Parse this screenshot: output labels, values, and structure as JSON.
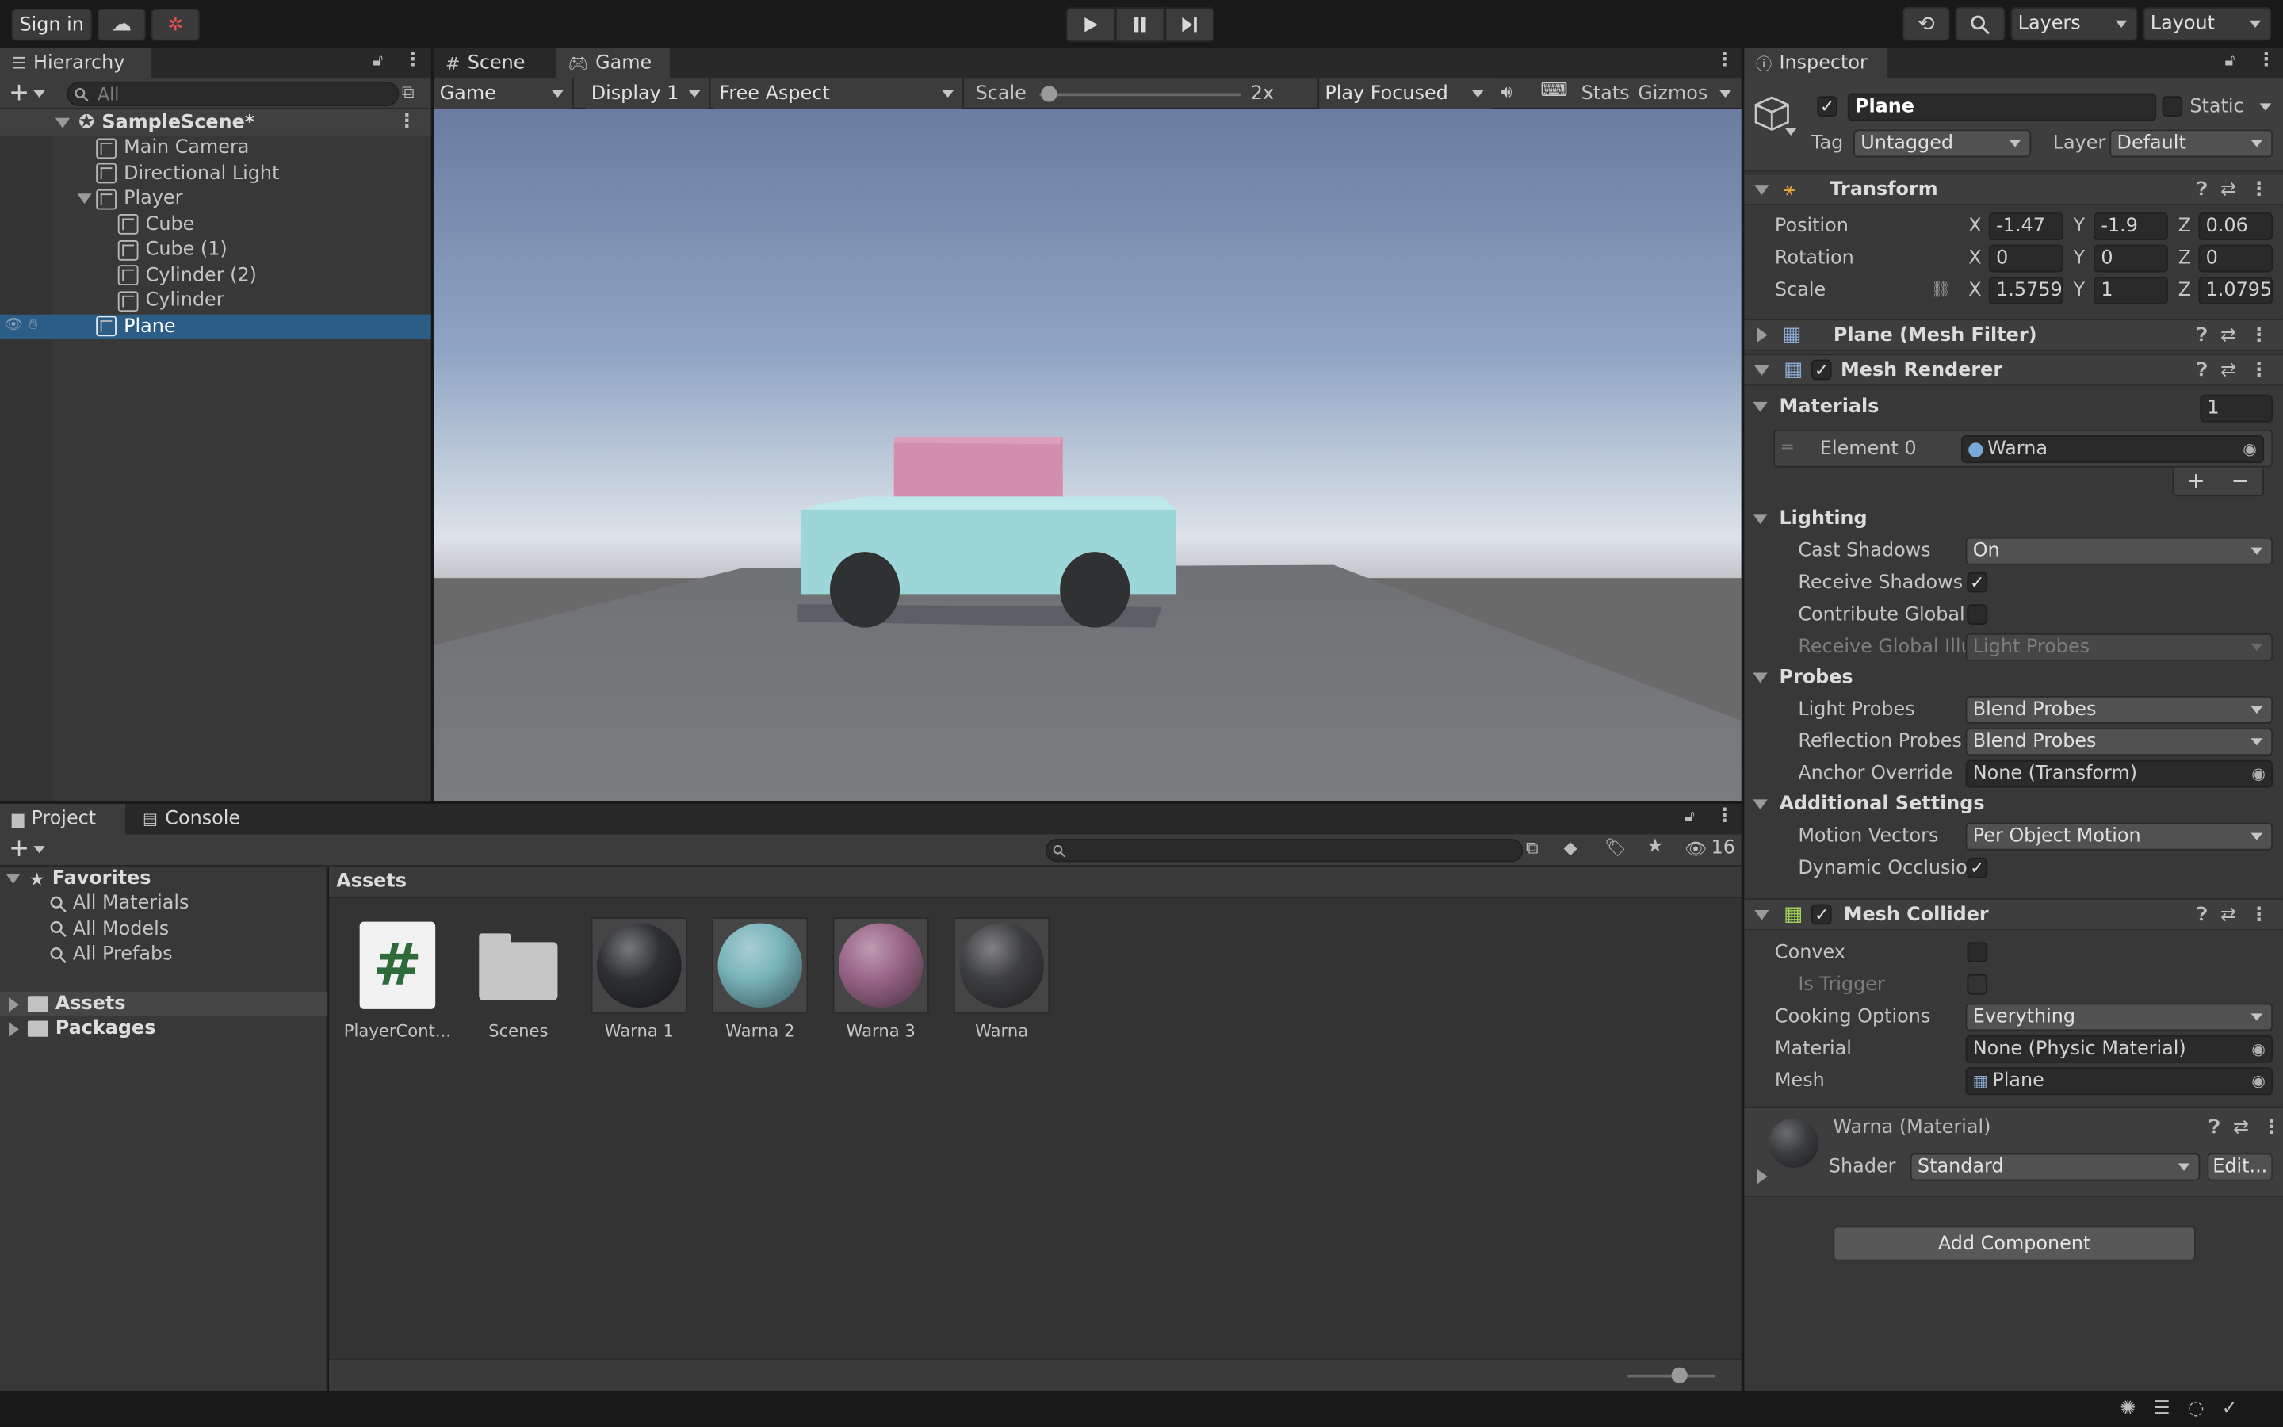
{
  "toolbar": {
    "sign_in": "Sign in",
    "layers": "Layers",
    "layout": "Layout"
  },
  "hierarchy": {
    "tab": "Hierarchy",
    "search_placeholder": "All",
    "scene_name": "SampleScene*",
    "items": [
      {
        "label": "Main Camera",
        "indent": 1
      },
      {
        "label": "Directional Light",
        "indent": 1
      },
      {
        "label": "Player",
        "indent": 1
      },
      {
        "label": "Cube",
        "indent": 2
      },
      {
        "label": "Cube (1)",
        "indent": 2
      },
      {
        "label": "Cylinder (2)",
        "indent": 2
      },
      {
        "label": "Cylinder",
        "indent": 2
      },
      {
        "label": "Plane",
        "indent": 1
      }
    ]
  },
  "view": {
    "tabs": [
      "Scene",
      "Game"
    ],
    "game_dd": "Game",
    "display": "Display 1",
    "aspect": "Free Aspect",
    "scale_label": "Scale",
    "scale_value": 0.02,
    "scale_readout": "2x",
    "play_mode": "Play Focused",
    "stats": "Stats",
    "gizmos": "Gizmos"
  },
  "project": {
    "tabs": [
      "Project",
      "Console"
    ],
    "hidden_count": "16",
    "favorites_label": "Favorites",
    "favorites": [
      "All Materials",
      "All Models",
      "All Prefabs"
    ],
    "roots": [
      "Assets",
      "Packages"
    ],
    "breadcrumb": "Assets",
    "assets": [
      {
        "label": "PlayerCont...",
        "kind": "script"
      },
      {
        "label": "Scenes",
        "kind": "folder"
      },
      {
        "label": "Warna 1",
        "kind": "material",
        "color": "#2e3034"
      },
      {
        "label": "Warna 2",
        "kind": "material",
        "color": "#79b4bb"
      },
      {
        "label": "Warna 3",
        "kind": "material",
        "color": "#9a6688"
      },
      {
        "label": "Warna",
        "kind": "material",
        "color": "#3e3f42"
      }
    ]
  },
  "inspector": {
    "tab": "Inspector",
    "object_name": "Plane",
    "static_label": "Static",
    "tag_label": "Tag",
    "tag_value": "Untagged",
    "layer_label": "Layer",
    "layer_value": "Default",
    "transform": {
      "title": "Transform",
      "rows": [
        {
          "label": "Position",
          "x": "-1.47",
          "y": "-1.9",
          "z": "0.06"
        },
        {
          "label": "Rotation",
          "x": "0",
          "y": "0",
          "z": "0"
        },
        {
          "label": "Scale",
          "x": "1.57593",
          "y": "1",
          "z": "1.0795"
        }
      ]
    },
    "mesh_filter": "Plane (Mesh Filter)",
    "mesh_renderer": "Mesh Renderer",
    "materials_label": "Materials",
    "materials_count": "1",
    "element0_label": "Element 0",
    "element0_value": "Warna",
    "lighting": {
      "title": "Lighting",
      "cast_shadows_label": "Cast Shadows",
      "cast_shadows": "On",
      "receive_shadows_label": "Receive Shadows",
      "contribute_gi_label": "Contribute Global I",
      "receive_gi_label": "Receive Global Illu",
      "receive_gi_value": "Light Probes"
    },
    "probes": {
      "title": "Probes",
      "light_probes_label": "Light Probes",
      "light_probes": "Blend Probes",
      "reflection_probes_label": "Reflection Probes",
      "reflection_probes": "Blend Probes",
      "anchor_label": "Anchor Override",
      "anchor_value": "None (Transform)"
    },
    "additional": {
      "title": "Additional Settings",
      "motion_label": "Motion Vectors",
      "motion_value": "Per Object Motion",
      "dynamic_label": "Dynamic Occlusioi"
    },
    "collider": {
      "title": "Mesh Collider",
      "convex_label": "Convex",
      "trigger_label": "Is Trigger",
      "cooking_label": "Cooking Options",
      "cooking_value": "Everything",
      "material_label": "Material",
      "material_value": "None (Physic Material)",
      "mesh_label": "Mesh",
      "mesh_value": "Plane"
    },
    "material_block": {
      "title": "Warna (Material)",
      "shader_label": "Shader",
      "shader_value": "Standard",
      "edit": "Edit..."
    },
    "add_component": "Add Component"
  }
}
